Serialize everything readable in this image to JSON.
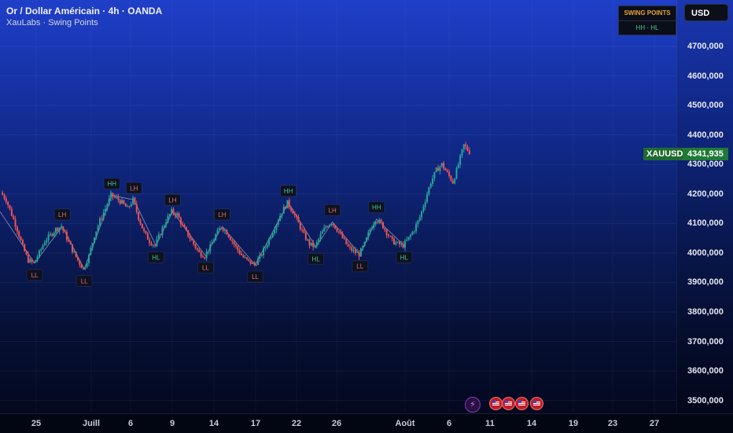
{
  "header": {
    "title": "Or / Dollar Américain · 4h · OANDA",
    "subtitle": "XauLabs · Swing Points"
  },
  "currency_button": "USD",
  "legend": {
    "title": "SWING POINTS",
    "row": "HH · HL"
  },
  "price_tag": {
    "symbol": "XAUUSD",
    "price": "4341,935"
  },
  "colors": {
    "up": "#26a69a",
    "down": "#ef5350",
    "label_green": "#4fc08d",
    "label_red": "#ef6b6b",
    "legend_title": "#e8a23a",
    "price_tag": "#1e7a36"
  },
  "events": {
    "bolt_icon": "lightning-icon",
    "flag_icons": [
      "us-flag-icon",
      "us-flag-icon",
      "us-flag-icon",
      "us-flag-icon"
    ]
  },
  "chart_data": {
    "type": "candlestick",
    "symbol": "XAUUSD",
    "timeframe": "4h",
    "y_ticks": [
      "4700,000",
      "4600,000",
      "4500,000",
      "4400,000",
      "4300,000",
      "4200,000",
      "4100,000",
      "4000,000",
      "3900,000",
      "3800,000",
      "3700,000",
      "3600,000",
      "3500,000"
    ],
    "x_ticks": [
      "25",
      "Juill",
      "6",
      "9",
      "14",
      "17",
      "22",
      "26",
      "Août",
      "6",
      "11",
      "14",
      "19",
      "23",
      "27"
    ],
    "ylim": [
      3480,
      4760
    ],
    "last_price": 4341.935,
    "swing_points": [
      {
        "label": "LL",
        "price": 3965,
        "type": "low"
      },
      {
        "label": "LH",
        "price": 4090,
        "type": "high"
      },
      {
        "label": "LL",
        "price": 3945,
        "type": "low"
      },
      {
        "label": "HH",
        "price": 4195,
        "type": "high"
      },
      {
        "label": "LH",
        "price": 4180,
        "type": "high"
      },
      {
        "label": "HL",
        "price": 4025,
        "type": "low"
      },
      {
        "label": "LH",
        "price": 4140,
        "type": "high"
      },
      {
        "label": "LL",
        "price": 3990,
        "type": "low"
      },
      {
        "label": "LH",
        "price": 4090,
        "type": "high"
      },
      {
        "label": "LL",
        "price": 3960,
        "type": "low"
      },
      {
        "label": "HH",
        "price": 4170,
        "type": "high"
      },
      {
        "label": "HL",
        "price": 4020,
        "type": "low"
      },
      {
        "label": "LH",
        "price": 4105,
        "type": "high"
      },
      {
        "label": "LL",
        "price": 3995,
        "type": "low"
      },
      {
        "label": "HH",
        "price": 4115,
        "type": "high"
      },
      {
        "label": "HL",
        "price": 4025,
        "type": "low"
      }
    ],
    "path_prices": [
      4205,
      4180,
      4130,
      4080,
      4020,
      3975,
      3965,
      4000,
      4040,
      4060,
      4080,
      4090,
      4050,
      4010,
      3975,
      3945,
      3990,
      4060,
      4110,
      4150,
      4195,
      4185,
      4170,
      4150,
      4180,
      4120,
      4070,
      4040,
      4025,
      4070,
      4110,
      4140,
      4130,
      4090,
      4060,
      4030,
      4000,
      3990,
      4020,
      4060,
      4090,
      4070,
      4040,
      4010,
      3985,
      3970,
      3960,
      3985,
      4020,
      4060,
      4100,
      4140,
      4170,
      4140,
      4100,
      4060,
      4030,
      4020,
      4060,
      4090,
      4105,
      4080,
      4050,
      4020,
      4005,
      3995,
      4030,
      4080,
      4115,
      4100,
      4070,
      4040,
      4030,
      4025,
      4050,
      4080,
      4120,
      4180,
      4240,
      4280,
      4300,
      4270,
      4240,
      4300,
      4365,
      4341.935
    ]
  }
}
